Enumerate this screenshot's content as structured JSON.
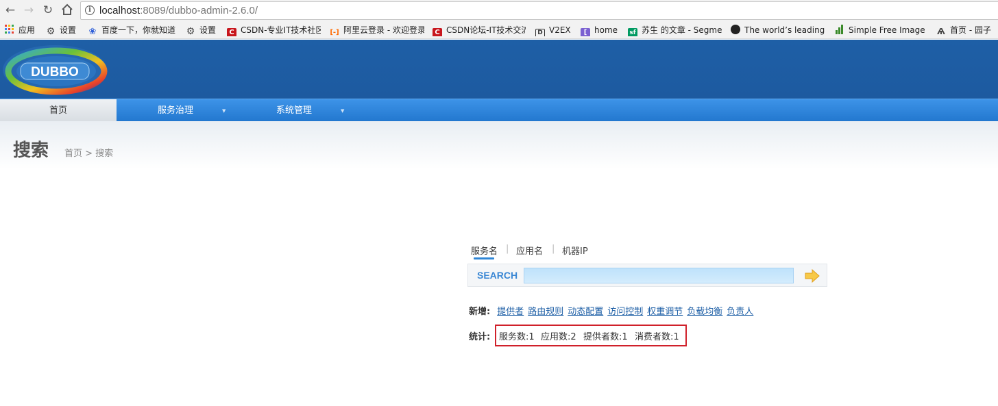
{
  "browser": {
    "url_host": "localhost",
    "url_rest": ":8089/dubbo-admin-2.6.0/"
  },
  "bookmarks": [
    {
      "label": "应用",
      "icon": "apps-grid-icon"
    },
    {
      "label": "设置",
      "icon": "gear-icon"
    },
    {
      "label": "百度一下，你就知道",
      "icon": "baidu-paw-icon"
    },
    {
      "label": "设置",
      "icon": "gear-icon"
    },
    {
      "label": "CSDN-专业IT技术社区",
      "icon": "csdn-icon"
    },
    {
      "label": "阿里云登录 - 欢迎登录",
      "icon": "aliyun-icon"
    },
    {
      "label": "CSDN论坛-IT技术交流",
      "icon": "csdn-icon"
    },
    {
      "label": "V2EX",
      "icon": "v2ex-icon"
    },
    {
      "label": "home",
      "icon": "home-bookmark-icon"
    },
    {
      "label": "苏生 的文章 - Segmentfault",
      "icon": "segmentfault-icon"
    },
    {
      "label": "The world’s leading",
      "icon": "github-icon"
    },
    {
      "label": "Simple Free Image Hosting",
      "icon": "bars-icon"
    },
    {
      "label": "首页 - 园子",
      "icon": "cnblogs-icon"
    }
  ],
  "app": {
    "logo_text": "DUBBO",
    "nav": [
      {
        "label": "首页"
      },
      {
        "label": "服务治理"
      },
      {
        "label": "系统管理"
      }
    ],
    "page_title": "搜索",
    "breadcrumb": "首页 > 搜索"
  },
  "search": {
    "tabs": [
      "服务名",
      "应用名",
      "机器IP"
    ],
    "active_tab": "服务名",
    "label": "SEARCH",
    "value": ""
  },
  "add_row": {
    "label": "新增:",
    "links": [
      "提供者",
      "路由规则",
      "动态配置",
      "访问控制",
      "权重调节",
      "负载均衡",
      "负责人"
    ]
  },
  "stats_row": {
    "label": "统计:",
    "items": [
      "服务数:1",
      "应用数:2",
      "提供者数:1",
      "消费者数:1"
    ]
  }
}
